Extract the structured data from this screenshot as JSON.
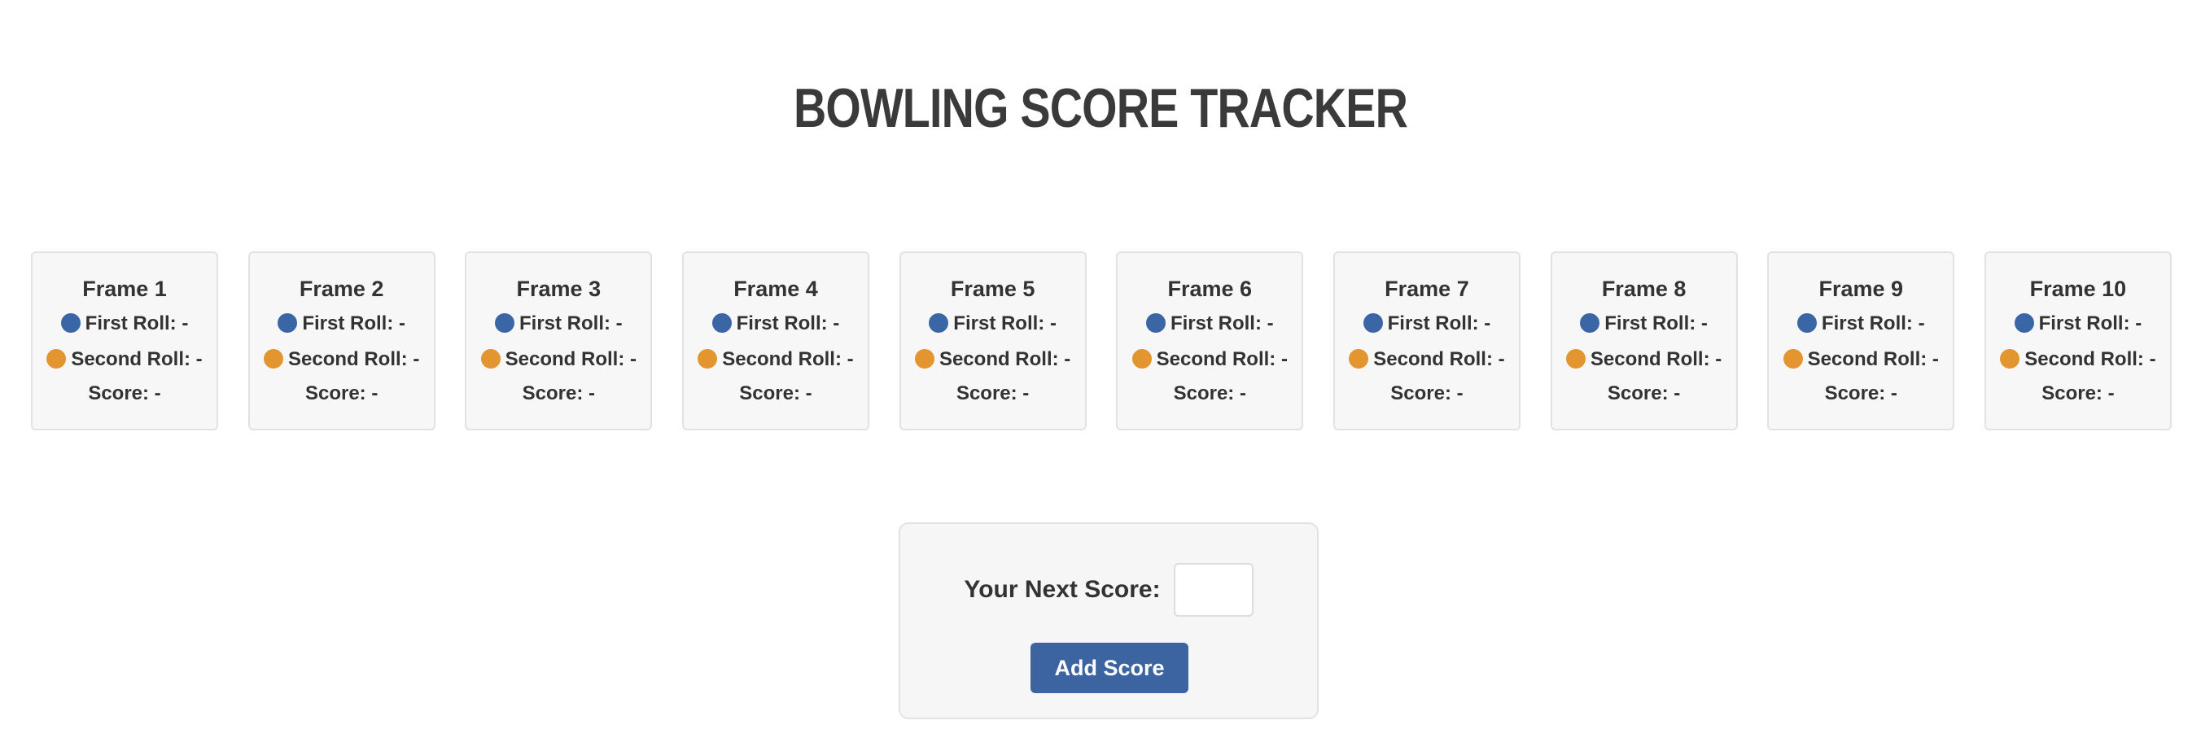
{
  "page": {
    "title": "Bowling Score Tracker"
  },
  "frames": [
    {
      "label": "Frame 1",
      "first_roll": "First Roll: -",
      "second_roll": "Second Roll: -",
      "score": "Score: -"
    },
    {
      "label": "Frame 2",
      "first_roll": "First Roll: -",
      "second_roll": "Second Roll: -",
      "score": "Score: -"
    },
    {
      "label": "Frame 3",
      "first_roll": "First Roll: -",
      "second_roll": "Second Roll: -",
      "score": "Score: -"
    },
    {
      "label": "Frame 4",
      "first_roll": "First Roll: -",
      "second_roll": "Second Roll: -",
      "score": "Score: -"
    },
    {
      "label": "Frame 5",
      "first_roll": "First Roll: -",
      "second_roll": "Second Roll: -",
      "score": "Score: -"
    },
    {
      "label": "Frame 6",
      "first_roll": "First Roll: -",
      "second_roll": "Second Roll: -",
      "score": "Score: -"
    },
    {
      "label": "Frame 7",
      "first_roll": "First Roll: -",
      "second_roll": "Second Roll: -",
      "score": "Score: -"
    },
    {
      "label": "Frame 8",
      "first_roll": "First Roll: -",
      "second_roll": "Second Roll: -",
      "score": "Score: -"
    },
    {
      "label": "Frame 9",
      "first_roll": "First Roll: -",
      "second_roll": "Second Roll: -",
      "score": "Score: -"
    },
    {
      "label": "Frame 10",
      "first_roll": "First Roll: -",
      "second_roll": "Second Roll: -",
      "score": "Score: -"
    }
  ],
  "controls": {
    "label": "Your Next Score:",
    "input_value": "",
    "button_label": "Add Score"
  },
  "colors": {
    "first_roll_dot": "#3b66a6",
    "second_roll_dot": "#e3952f",
    "button": "#3b64a0"
  },
  "icons": {
    "first_roll": "blue-circle-icon",
    "second_roll": "orange-circle-icon"
  }
}
